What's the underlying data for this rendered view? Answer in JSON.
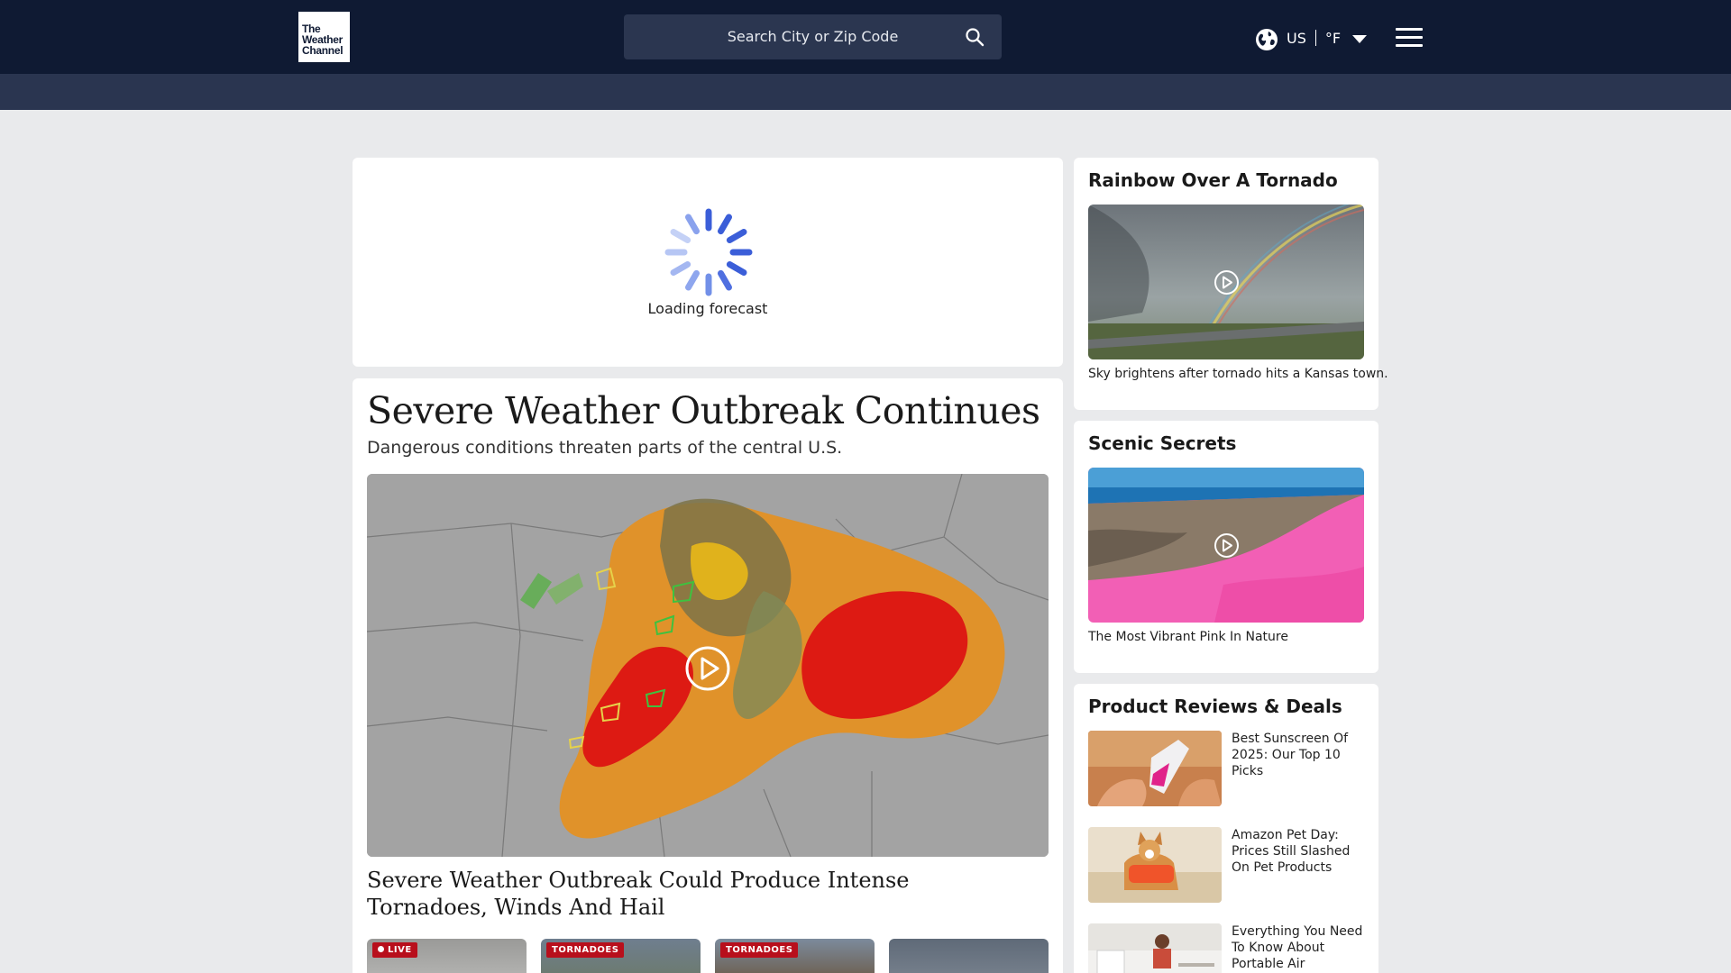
{
  "header": {
    "logo_lines": [
      "The",
      "Weather",
      "Channel"
    ],
    "search_placeholder": "Search City or Zip Code",
    "locale_country": "US",
    "locale_unit": "°F"
  },
  "forecast": {
    "loading_text": "Loading forecast"
  },
  "feature": {
    "title": "Severe Weather Outbreak Continues",
    "subtitle": "Dangerous conditions threaten parts of the central U.S.",
    "headline": "Severe Weather Outbreak Could Produce Intense Tornadoes, Winds And Hail",
    "thumbnails": [
      {
        "badge": "LIVE"
      },
      {
        "badge": "TORNADOES"
      },
      {
        "badge": "TORNADOES"
      },
      {
        "badge": ""
      }
    ]
  },
  "sidebar": {
    "video1": {
      "title": "Rainbow Over A Tornado",
      "caption": "Sky brightens after tornado hits a Kansas town."
    },
    "video2": {
      "title": "Scenic Secrets",
      "caption": "The Most Vibrant Pink In Nature"
    },
    "deals": {
      "title": "Product Reviews & Deals",
      "items": [
        {
          "title": "Best Sunscreen Of 2025: Our Top 10 Picks"
        },
        {
          "title": "Amazon Pet Day: Prices Still Slashed On Pet Products"
        },
        {
          "title": "Everything You Need To Know About Portable Air Conditioners"
        }
      ]
    }
  },
  "colors": {
    "header_bg": "#0f1a33",
    "subbar_bg": "#2a3550",
    "page_bg": "#e9eaec",
    "badge_red": "#b80f1c"
  }
}
